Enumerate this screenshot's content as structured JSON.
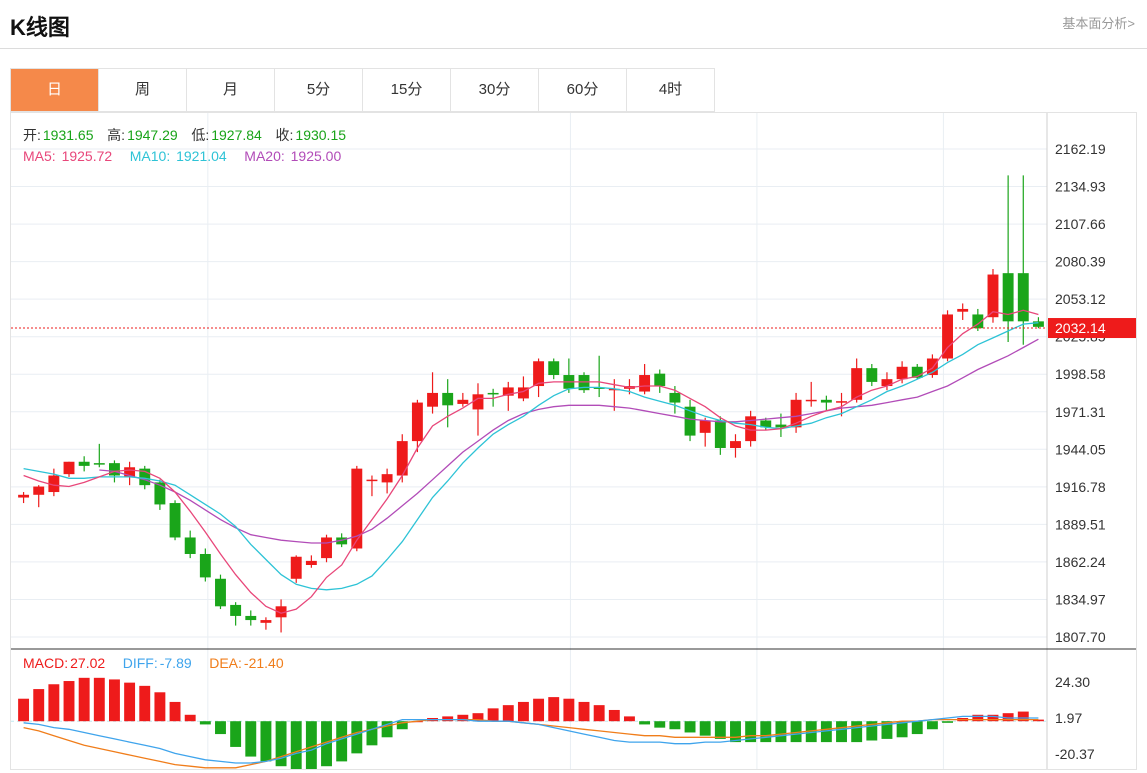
{
  "header": {
    "title": "K线图",
    "link": "基本面分析>"
  },
  "tabs": [
    {
      "label": "日",
      "active": true
    },
    {
      "label": "周",
      "active": false
    },
    {
      "label": "月",
      "active": false
    },
    {
      "label": "5分",
      "active": false
    },
    {
      "label": "15分",
      "active": false
    },
    {
      "label": "30分",
      "active": false
    },
    {
      "label": "60分",
      "active": false
    },
    {
      "label": "4时",
      "active": false
    }
  ],
  "ohlc_legend": {
    "open_label": "开:",
    "open": "1931.65",
    "high_label": "高:",
    "high": "1947.29",
    "low_label": "低:",
    "low": "1927.84",
    "close_label": "收:",
    "close": "1930.15"
  },
  "ma_legend": {
    "ma5_label": "MA5:",
    "ma5": "1925.72",
    "ma10_label": "MA10:",
    "ma10": "1921.04",
    "ma20_label": "MA20:",
    "ma20": "1925.00"
  },
  "macd_legend": {
    "macd_label": "MACD:",
    "macd": "27.02",
    "diff_label": "DIFF:",
    "diff": "-7.89",
    "dea_label": "DEA:",
    "dea": "-21.40"
  },
  "colors": {
    "up": "#ee1b1b",
    "down": "#1aa51a",
    "ma5": "#e8477a",
    "ma10": "#2ec3d6",
    "ma20": "#b24cb8",
    "diff": "#3fa4ec",
    "dea": "#f07d1a",
    "open": "#18a318",
    "accent": "#f5894a"
  },
  "chart_data": {
    "type": "candlestick",
    "price_ticks": [
      "2162.19",
      "2134.93",
      "2107.66",
      "2080.39",
      "2053.12",
      "2025.85",
      "1998.58",
      "1971.31",
      "1944.05",
      "1916.78",
      "1889.51",
      "1862.24",
      "1834.97",
      "1807.70"
    ],
    "price_range": [
      1807.7,
      2162.19
    ],
    "current_price": "2032.14",
    "current_price_value": 2032.14,
    "macd_ticks": [
      "24.30",
      "1.97",
      "-20.37"
    ],
    "macd_range": [
      -26,
      30
    ],
    "candles": [
      [
        1909,
        1913,
        1905,
        1911
      ],
      [
        1911,
        1918,
        1902,
        1917
      ],
      [
        1913,
        1930,
        1910,
        1925
      ],
      [
        1926,
        1935,
        1924,
        1935
      ],
      [
        1935,
        1939,
        1928,
        1932
      ],
      [
        1934,
        1948,
        1931,
        1933
      ],
      [
        1934,
        1936,
        1920,
        1925
      ],
      [
        1924,
        1935,
        1918,
        1931
      ],
      [
        1930,
        1932,
        1915,
        1918
      ],
      [
        1920,
        1922,
        1900,
        1904
      ],
      [
        1905,
        1907,
        1878,
        1880
      ],
      [
        1880,
        1885,
        1865,
        1868
      ],
      [
        1868,
        1872,
        1848,
        1851
      ],
      [
        1850,
        1853,
        1828,
        1830
      ],
      [
        1831,
        1833,
        1816,
        1823
      ],
      [
        1823,
        1827,
        1816,
        1820
      ],
      [
        1818,
        1822,
        1813,
        1820
      ],
      [
        1822,
        1835,
        1811,
        1830
      ],
      [
        1850,
        1867,
        1847,
        1866
      ],
      [
        1860,
        1867,
        1858,
        1863
      ],
      [
        1865,
        1882,
        1862,
        1880
      ],
      [
        1880,
        1883,
        1873,
        1875
      ],
      [
        1872,
        1932,
        1870,
        1930
      ],
      [
        1922,
        1925,
        1910,
        1922
      ],
      [
        1920,
        1930,
        1912,
        1926
      ],
      [
        1925,
        1955,
        1920,
        1950
      ],
      [
        1950,
        1980,
        1942,
        1978
      ],
      [
        1975,
        2000,
        1970,
        1985
      ],
      [
        1985,
        1995,
        1960,
        1976
      ],
      [
        1977,
        1985,
        1975,
        1980
      ],
      [
        1973,
        1992,
        1954,
        1984
      ],
      [
        1985,
        1988,
        1975,
        1984
      ],
      [
        1983,
        1993,
        1972,
        1989
      ],
      [
        1981,
        1997,
        1979,
        1989
      ],
      [
        1990,
        2010,
        1982,
        2008
      ],
      [
        2008,
        2010,
        1995,
        1998
      ],
      [
        1998,
        2010,
        1985,
        1988
      ],
      [
        1998,
        2000,
        1985,
        1987
      ],
      [
        1989,
        2012,
        1982,
        1988
      ],
      [
        1988,
        1995,
        1972,
        1988
      ],
      [
        1988,
        1995,
        1984,
        1990
      ],
      [
        1986,
        2006,
        1984,
        1998
      ],
      [
        1999,
        2002,
        1985,
        1990
      ],
      [
        1985,
        1990,
        1970,
        1978
      ],
      [
        1975,
        1980,
        1950,
        1954
      ],
      [
        1956,
        1967,
        1946,
        1965
      ],
      [
        1965,
        1968,
        1940,
        1945
      ],
      [
        1945,
        1955,
        1938,
        1950
      ],
      [
        1950,
        1972,
        1946,
        1968
      ],
      [
        1965,
        1967,
        1958,
        1960
      ],
      [
        1962,
        1970,
        1953,
        1960
      ],
      [
        1960,
        1985,
        1956,
        1980
      ],
      [
        1979,
        1993,
        1975,
        1980
      ],
      [
        1980,
        1983,
        1972,
        1978
      ],
      [
        1978,
        1985,
        1968,
        1979
      ],
      [
        1980,
        2010,
        1978,
        2003
      ],
      [
        2003,
        2006,
        1990,
        1993
      ],
      [
        1990,
        2000,
        1987,
        1995
      ],
      [
        1995,
        2008,
        1992,
        2004
      ],
      [
        2004,
        2006,
        1995,
        1996
      ],
      [
        1998,
        2013,
        1996,
        2010
      ],
      [
        2010,
        2045,
        2008,
        2042
      ],
      [
        2044,
        2050,
        2038,
        2046
      ],
      [
        2042,
        2046,
        2030,
        2032
      ],
      [
        2040,
        2075,
        2036,
        2071
      ],
      [
        2072,
        2143,
        2022,
        2037
      ],
      [
        2072,
        2143,
        2020,
        2037
      ],
      [
        2037,
        2040,
        2032,
        2033
      ]
    ],
    "ma5": [
      1925,
      1921,
      1918,
      1917,
      1920,
      1924,
      1928,
      1929,
      1928,
      1923,
      1913,
      1899,
      1884,
      1868,
      1853,
      1840,
      1830,
      1825,
      1828,
      1837,
      1851,
      1860,
      1878,
      1893,
      1908,
      1925,
      1945,
      1961,
      1968,
      1974,
      1981,
      1981,
      1984,
      1986,
      1992,
      1993,
      1993,
      1993,
      1993,
      1991,
      1989,
      1990,
      1990,
      1987,
      1981,
      1975,
      1967,
      1961,
      1958,
      1958,
      1959,
      1963,
      1968,
      1972,
      1975,
      1982,
      1987,
      1990,
      1995,
      1997,
      2003,
      2018,
      2028,
      2035,
      2044,
      2042,
      2045,
      2042
    ],
    "ma10": [
      1930,
      1928,
      1926,
      1923,
      1923,
      1924,
      1924,
      1924,
      1923,
      1921,
      1918,
      1911,
      1904,
      1897,
      1888,
      1875,
      1864,
      1853,
      1846,
      1843,
      1842,
      1843,
      1846,
      1852,
      1864,
      1877,
      1893,
      1909,
      1921,
      1934,
      1945,
      1955,
      1962,
      1968,
      1976,
      1983,
      1988,
      1989,
      1989,
      1988,
      1986,
      1982,
      1979,
      1976,
      1972,
      1968,
      1965,
      1963,
      1962,
      1960,
      1959,
      1961,
      1963,
      1967,
      1970,
      1975,
      1980,
      1986,
      1990,
      1995,
      2000,
      2007,
      2013,
      2020,
      2025,
      2030,
      2035,
      2036
    ],
    "ma20": [
      null,
      null,
      null,
      null,
      null,
      1929,
      1928,
      1925,
      1922,
      1918,
      1913,
      1907,
      1900,
      1893,
      1887,
      1882,
      1880,
      1878,
      1877,
      1876,
      1876,
      1878,
      1881,
      1886,
      1894,
      1903,
      1912,
      1922,
      1932,
      1942,
      1950,
      1958,
      1965,
      1970,
      1973,
      1975,
      1976,
      1976,
      1976,
      1975,
      1974,
      1972,
      1970,
      1968,
      1966,
      1965,
      1964,
      1964,
      1965,
      1966,
      1967,
      1968,
      1970,
      1972,
      1974,
      1975,
      1976,
      1978,
      1980,
      1982,
      1986,
      1990,
      1996,
      2002,
      2007,
      2012,
      2018,
      2024
    ],
    "macd_hist": [
      14,
      20,
      23,
      25,
      27,
      27,
      26,
      24,
      22,
      18,
      12,
      4,
      -2,
      -8,
      -16,
      -22,
      -25,
      -28,
      -30,
      -30,
      -28,
      -25,
      -20,
      -15,
      -10,
      -5,
      0,
      2,
      3,
      4,
      5,
      8,
      10,
      12,
      14,
      15,
      14,
      12,
      10,
      7,
      3,
      -2,
      -4,
      -5,
      -7,
      -9,
      -11,
      -13,
      -13,
      -13,
      -13,
      -13,
      -13,
      -13,
      -13,
      -13,
      -12,
      -11,
      -10,
      -8,
      -5,
      -1,
      2,
      4,
      4,
      5,
      6,
      1
    ],
    "diff": [
      -1,
      -2,
      -4,
      -5,
      -7,
      -9,
      -11,
      -13,
      -15,
      -17,
      -20,
      -22,
      -24,
      -25,
      -26,
      -26,
      -25,
      -23,
      -20,
      -18,
      -14,
      -11,
      -8,
      -5,
      -2,
      1,
      1,
      1,
      1,
      1,
      0,
      0,
      0,
      -1,
      -2,
      -4,
      -6,
      -8,
      -10,
      -12,
      -13,
      -13,
      -13,
      -14,
      -14,
      -13,
      -13,
      -12,
      -11,
      -10,
      -9,
      -8,
      -7,
      -6,
      -5,
      -4,
      -3,
      -2,
      -1,
      0,
      1,
      2,
      3,
      3,
      3,
      2,
      2,
      2
    ],
    "dea": [
      -4,
      -6,
      -9,
      -12,
      -15,
      -17,
      -19,
      -21,
      -23,
      -25,
      -27,
      -28,
      -29,
      -29,
      -29,
      -27,
      -25,
      -22,
      -19,
      -16,
      -13,
      -10,
      -7,
      -5,
      -3,
      -1,
      0,
      1,
      1,
      1,
      1,
      0,
      0,
      -1,
      -2,
      -3,
      -4,
      -5,
      -6,
      -7,
      -8,
      -9,
      -9,
      -10,
      -10,
      -10,
      -10,
      -10,
      -9,
      -9,
      -8,
      -7,
      -6,
      -5,
      -4,
      -3,
      -2,
      -1,
      0,
      0,
      1,
      1,
      1,
      1,
      1,
      1,
      1,
      1
    ]
  }
}
